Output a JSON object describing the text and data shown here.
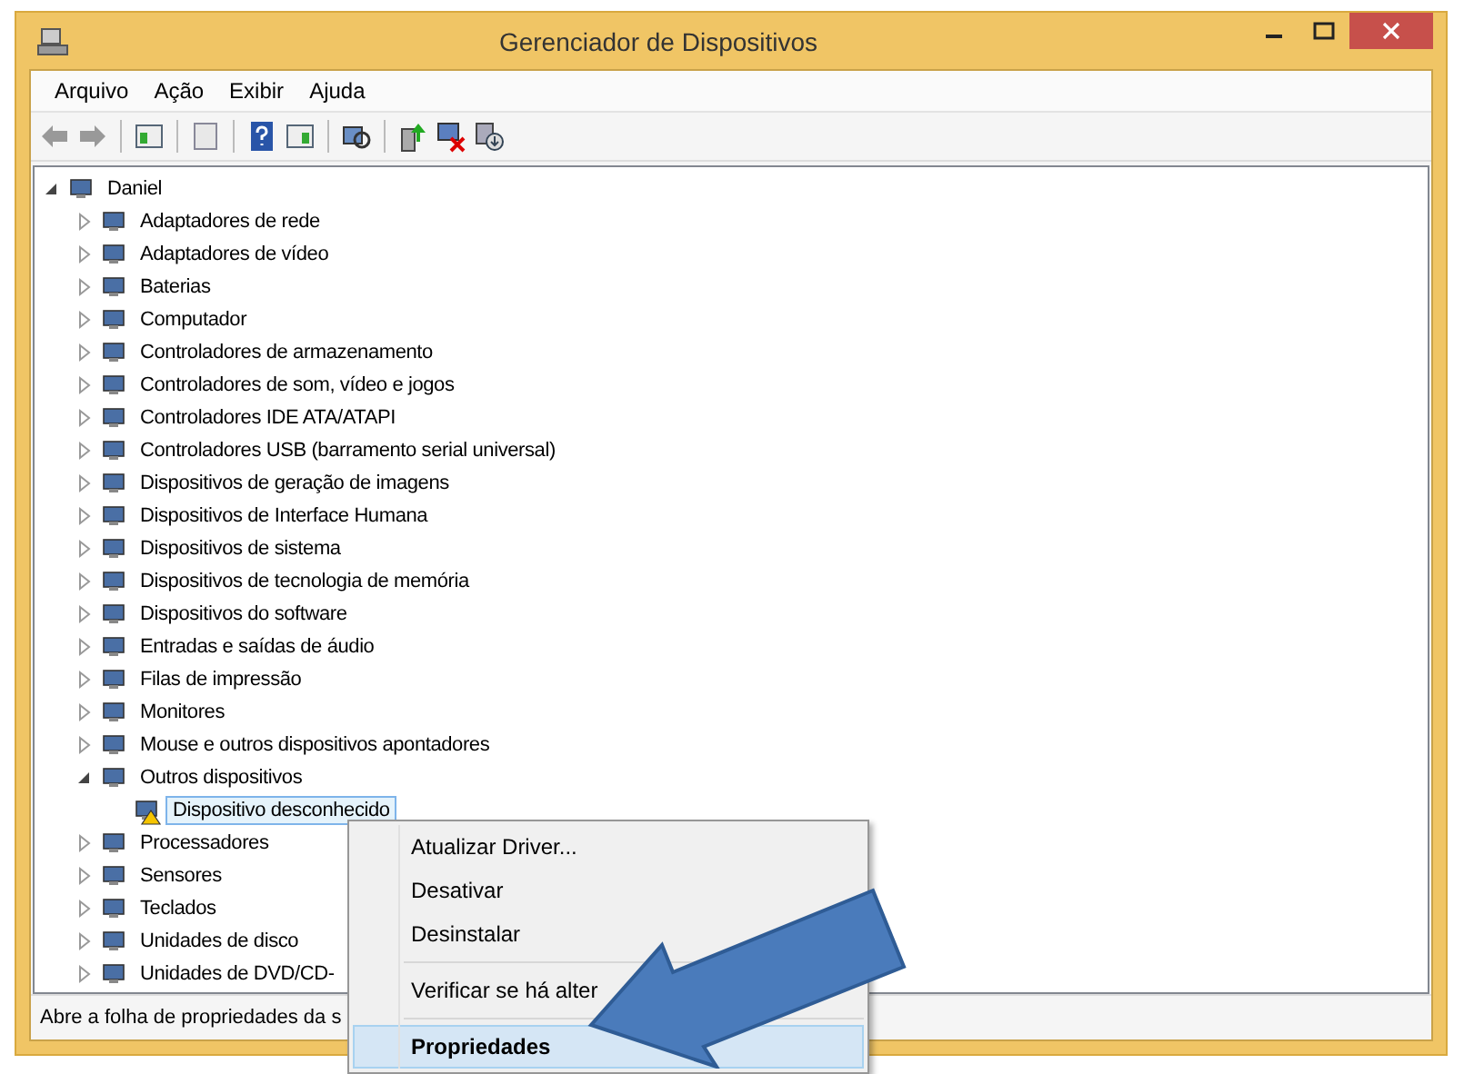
{
  "window": {
    "title": "Gerenciador de Dispositivos"
  },
  "menu": [
    "Arquivo",
    "Ação",
    "Exibir",
    "Ajuda"
  ],
  "tree": {
    "label": "Daniel",
    "expanded": true,
    "children": [
      {
        "label": "Adaptadores de rede",
        "expanded": false
      },
      {
        "label": "Adaptadores de vídeo",
        "expanded": false
      },
      {
        "label": "Baterias",
        "expanded": false
      },
      {
        "label": "Computador",
        "expanded": false
      },
      {
        "label": "Controladores de armazenamento",
        "expanded": false
      },
      {
        "label": "Controladores de som, vídeo e jogos",
        "expanded": false
      },
      {
        "label": "Controladores IDE ATA/ATAPI",
        "expanded": false
      },
      {
        "label": "Controladores USB (barramento serial universal)",
        "expanded": false
      },
      {
        "label": "Dispositivos de geração de imagens",
        "expanded": false
      },
      {
        "label": "Dispositivos de Interface Humana",
        "expanded": false
      },
      {
        "label": "Dispositivos de sistema",
        "expanded": false
      },
      {
        "label": "Dispositivos de tecnologia de memória",
        "expanded": false
      },
      {
        "label": "Dispositivos do software",
        "expanded": false
      },
      {
        "label": "Entradas e saídas de áudio",
        "expanded": false
      },
      {
        "label": "Filas de impressão",
        "expanded": false
      },
      {
        "label": "Monitores",
        "expanded": false
      },
      {
        "label": "Mouse e outros dispositivos apontadores",
        "expanded": false
      },
      {
        "label": "Outros dispositivos",
        "expanded": true,
        "children": [
          {
            "label": "Dispositivo desconhecido",
            "selected": true,
            "warning": true
          }
        ]
      },
      {
        "label": "Processadores",
        "expanded": false
      },
      {
        "label": "Sensores",
        "expanded": false
      },
      {
        "label": "Teclados",
        "expanded": false
      },
      {
        "label": "Unidades de disco",
        "expanded": false
      },
      {
        "label": "Unidades de DVD/CD-",
        "expanded": false
      }
    ]
  },
  "context_menu": [
    {
      "kind": "item",
      "label": "Atualizar Driver...",
      "selected": false
    },
    {
      "kind": "item",
      "label": "Desativar",
      "selected": false
    },
    {
      "kind": "item",
      "label": "Desinstalar",
      "selected": false
    },
    {
      "kind": "separator"
    },
    {
      "kind": "item",
      "label": "Verificar se há alter",
      "selected": false
    },
    {
      "kind": "separator"
    },
    {
      "kind": "item",
      "label": "Propriedades",
      "selected": true,
      "default": true
    }
  ],
  "status_bar": "Abre a folha de propriedades da s"
}
